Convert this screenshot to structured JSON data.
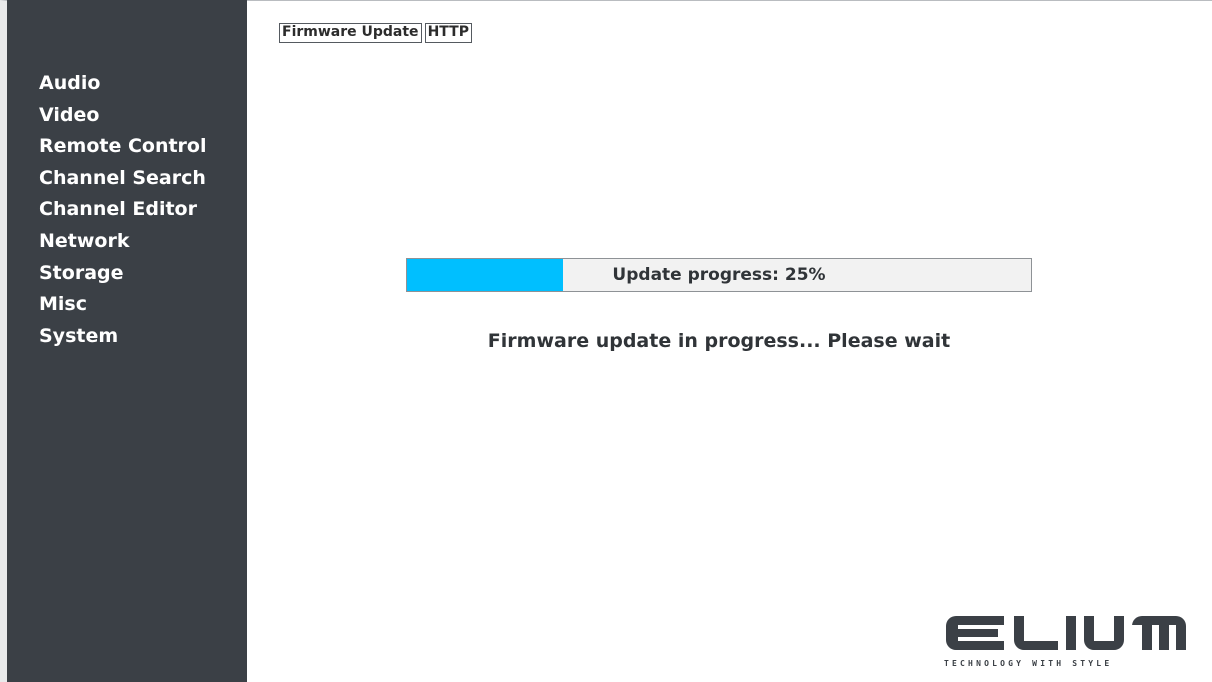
{
  "sidebar": {
    "items": [
      {
        "label": "Audio"
      },
      {
        "label": "Video"
      },
      {
        "label": "Remote Control"
      },
      {
        "label": "Channel Search"
      },
      {
        "label": "Channel Editor"
      },
      {
        "label": "Network"
      },
      {
        "label": "Storage"
      },
      {
        "label": "Misc"
      },
      {
        "label": "System"
      }
    ]
  },
  "breadcrumb": {
    "items": [
      {
        "label": "Firmware Update"
      },
      {
        "label": "HTTP"
      }
    ]
  },
  "progress": {
    "percent": 25,
    "label": "Update progress: 25%",
    "fill_color": "#00bfff"
  },
  "status": {
    "message": "Firmware update in progress... Please wait"
  },
  "logo": {
    "name": "elium-logo",
    "tagline": "TECHNOLOGY WITH STYLE"
  },
  "colors": {
    "sidebar_bg": "#3b4046",
    "accent": "#00bfff"
  }
}
